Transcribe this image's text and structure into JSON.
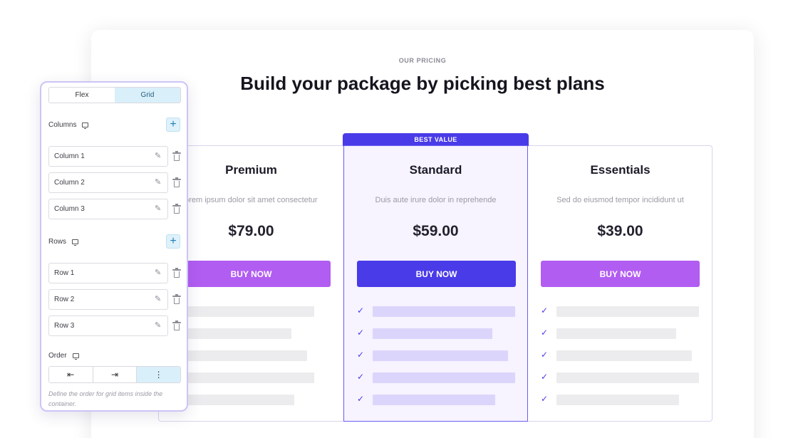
{
  "pricing": {
    "eyebrow": "OUR PRICING",
    "heading": "Build your package by picking best plans",
    "badge": "BEST VALUE",
    "plans": [
      {
        "name": "Premium",
        "description": "Lorem ipsum dolor sit amet consectetur",
        "price": "$79.00",
        "button": "BUY NOW",
        "feature_count": 5,
        "checked": false
      },
      {
        "name": "Standard",
        "description": "Duis aute irure dolor in reprehende",
        "price": "$59.00",
        "button": "BUY NOW",
        "feature_count": 5,
        "checked": true
      },
      {
        "name": "Essentials",
        "description": "Sed do eiusmod tempor incididunt ut",
        "price": "$39.00",
        "button": "BUY NOW",
        "feature_count": 5,
        "checked": true
      }
    ],
    "colors": {
      "accent": "#4a3be8",
      "buy_button": "#b25df2",
      "highlight_bg": "#f7f3ff"
    }
  },
  "panel": {
    "tabs": [
      "Flex",
      "Grid"
    ],
    "active_tab": "Grid",
    "columns_label": "Columns",
    "columns": [
      "Column 1",
      "Column 2",
      "Column 3"
    ],
    "rows_label": "Rows",
    "rows": [
      "Row 1",
      "Row 2",
      "Row 3"
    ],
    "order_label": "Order",
    "order_options": [
      {
        "icon": "align-start-icon",
        "glyph": "⇤"
      },
      {
        "icon": "align-end-icon",
        "glyph": "⇥"
      },
      {
        "icon": "more-vertical-icon",
        "glyph": "⋮"
      }
    ],
    "help_text": "Define the order for grid items inside the container.",
    "add_glyph": "+",
    "edit_glyph": "✎"
  }
}
